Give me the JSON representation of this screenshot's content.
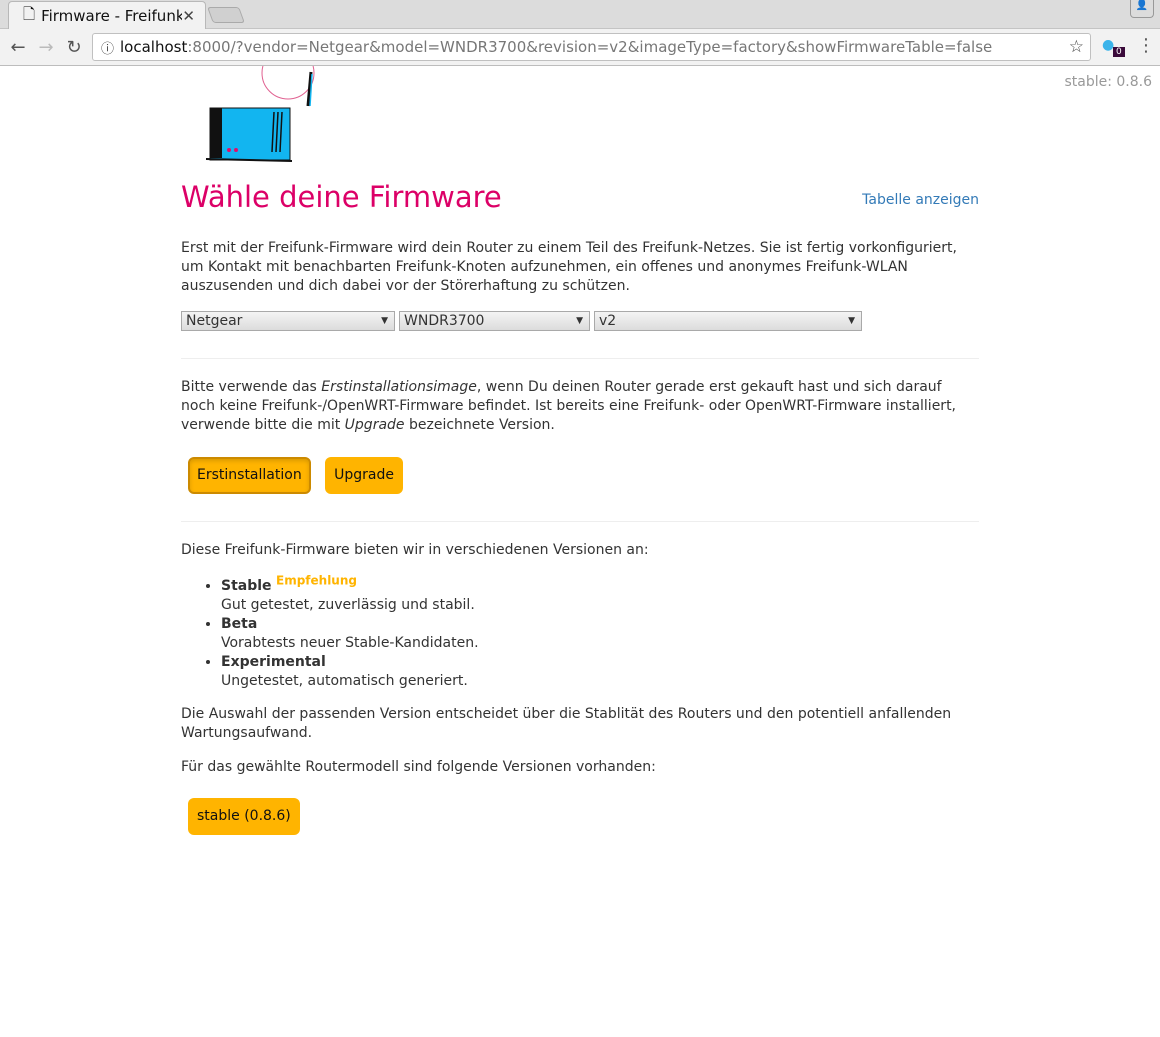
{
  "browser": {
    "tab_title": "Firmware - Freifunk",
    "url_host": "localhost",
    "url_rest": ":8000/?vendor=Netgear&model=WNDR3700&revision=v2&imageType=factory&showFirmwareTable=false",
    "extension_badge": "0"
  },
  "version_label": "stable: 0.8.6",
  "heading": "Wähle deine Firmware",
  "table_link": "Tabelle anzeigen",
  "intro": "Erst mit der Freifunk-Firmware wird dein Router zu einem Teil des Freifunk-Netzes. Sie ist fertig vorkonfiguriert, um Kontakt mit benachbarten Freifunk-Knoten aufzunehmen, ein offenes und anonymes Freifunk-WLAN auszusenden und dich dabei vor der Störerhaftung zu schützen.",
  "selects": {
    "vendor": "Netgear",
    "model": "WNDR3700",
    "revision": "v2"
  },
  "image_info": {
    "p1": "Bitte verwende das ",
    "em1": "Erstinstallationsimage",
    "p2": ", wenn Du deinen Router gerade erst gekauft hast und sich darauf noch keine Freifunk-/OpenWRT-Firmware befindet. Ist bereits eine Freifunk- oder OpenWRT-Firmware installiert, verwende bitte die mit ",
    "em2": "Upgrade",
    "p3": " bezeichnete Version."
  },
  "buttons": {
    "factory": "Erstinstallation",
    "sysupgrade": "Upgrade"
  },
  "versions_intro": "Diese Freifunk-Firmware bieten wir in verschiedenen Versionen an:",
  "branches": [
    {
      "name": "Stable",
      "tag": "Empfehlung",
      "desc": "Gut getestet, zuverlässig und stabil."
    },
    {
      "name": "Beta",
      "desc": "Vorabtests neuer Stable-Kandidaten."
    },
    {
      "name": "Experimental",
      "desc": "Ungetestet, automatisch generiert."
    }
  ],
  "stability_note": "Die Auswahl der passenden Version entscheidet über die Stablität des Routers und den potentiell anfallenden Wartungsaufwand.",
  "available_intro": "Für das gewählte Routermodell sind folgende Versionen vorhanden:",
  "download_button": "stable (0.8.6)"
}
